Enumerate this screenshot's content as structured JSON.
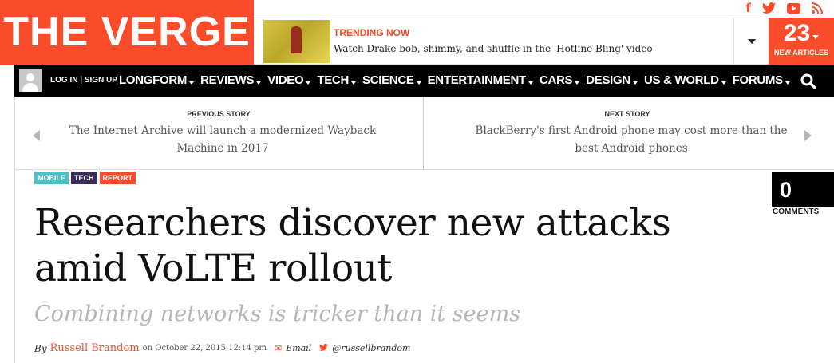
{
  "brand": {
    "logo_text": "THE VERGE",
    "accent": "#fa4b2a"
  },
  "social": [
    {
      "name": "facebook-icon",
      "glyph": "f"
    },
    {
      "name": "twitter-icon",
      "glyph": ""
    },
    {
      "name": "youtube-icon",
      "glyph": ""
    },
    {
      "name": "rss-icon",
      "glyph": ""
    }
  ],
  "trending": {
    "label": "TRENDING NOW",
    "text": "Watch Drake bob, shimmy, and shuffle in the 'Hotline Bling' video"
  },
  "new_articles": {
    "count": "23",
    "label": "NEW ARTICLES"
  },
  "nav": {
    "login": "LOG IN | SIGN UP",
    "items": [
      "LONGFORM",
      "REVIEWS",
      "VIDEO",
      "TECH",
      "SCIENCE",
      "ENTERTAINMENT",
      "CARS",
      "DESIGN",
      "US & WORLD",
      "FORUMS"
    ]
  },
  "story_nav": {
    "prev_kicker": "PREVIOUS STORY",
    "prev_title": "The Internet Archive will launch a modernized Wayback Machine in 2017",
    "next_kicker": "NEXT STORY",
    "next_title": "BlackBerry's first Android phone may cost more than the best Android phones"
  },
  "tags": [
    {
      "label": "MOBILE",
      "color": "#4bc0c8"
    },
    {
      "label": "TECH",
      "color": "#3a2d5c"
    },
    {
      "label": "REPORT",
      "color": "#fa4b2a"
    }
  ],
  "comments": {
    "count": "0",
    "label": "COMMENTS"
  },
  "article": {
    "headline": "Researchers discover new attacks amid VoLTE rollout",
    "dek": "Combining networks is tricker than it seems",
    "byline_by": "By",
    "author": "Russell Brandom",
    "date": "on October 22, 2015 12:14 pm",
    "email_label": "Email",
    "twitter_handle": "@russellbrandom"
  }
}
